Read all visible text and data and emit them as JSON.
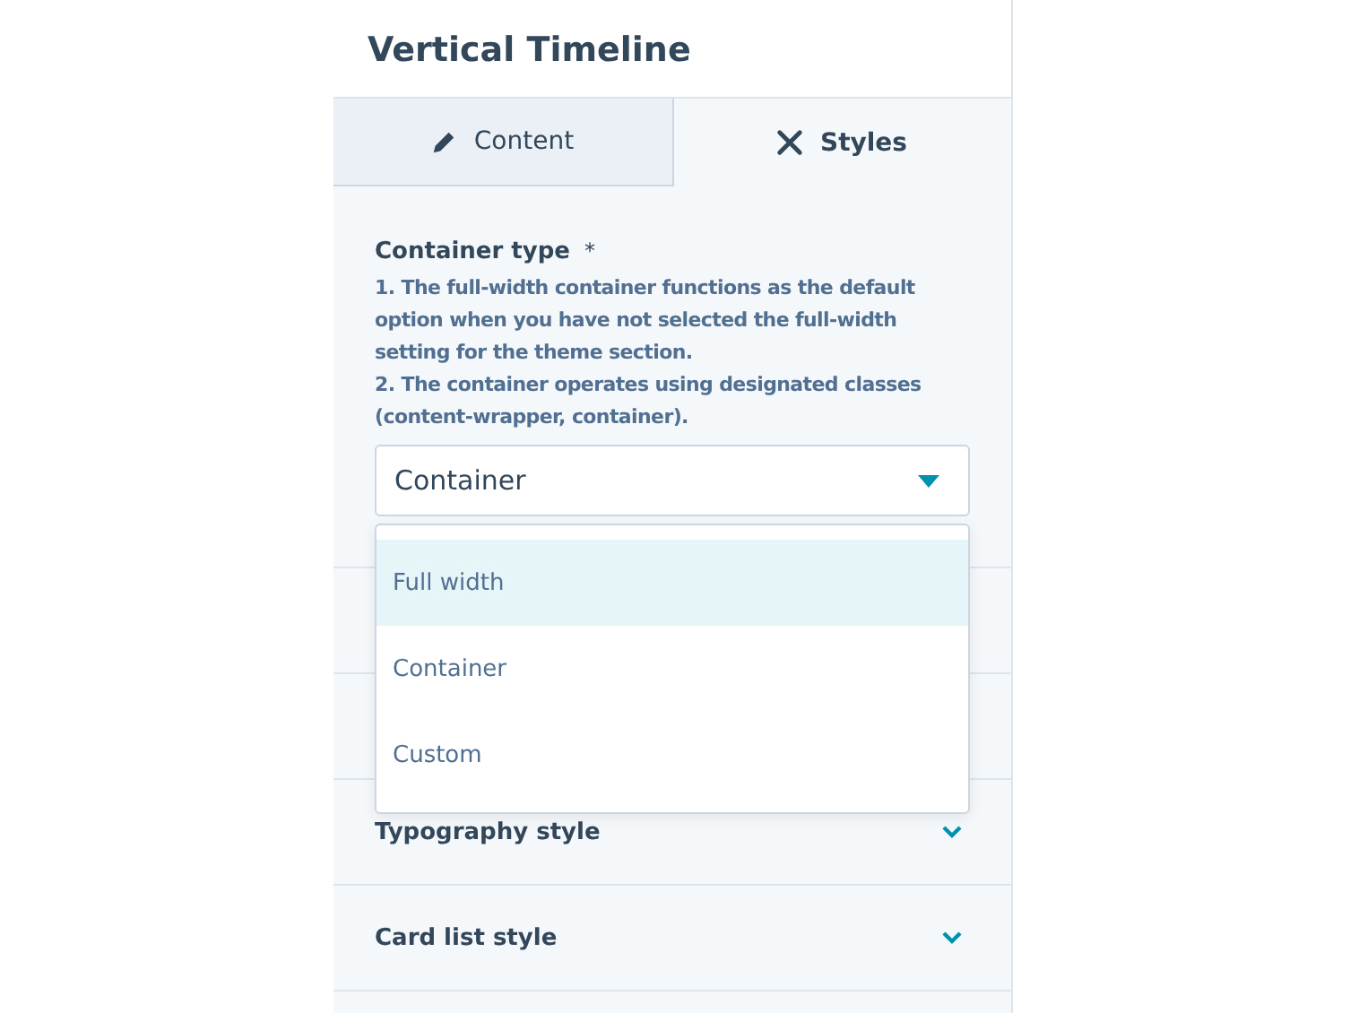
{
  "panel": {
    "title": "Vertical Timeline"
  },
  "tabs": [
    {
      "label": "Content",
      "selected": false
    },
    {
      "label": "Styles",
      "selected": true
    }
  ],
  "field": {
    "label": "Container type",
    "required_mark": "*",
    "help": [
      "1. The full-width container functions as the default option when you have not selected the full-width setting for the theme section.",
      "2. The container operates using designated classes (content-wrapper, container)."
    ],
    "value": "Container",
    "options": [
      {
        "label": "Full width",
        "highlighted": true
      },
      {
        "label": "Container",
        "highlighted": false
      },
      {
        "label": "Custom",
        "highlighted": false
      }
    ]
  },
  "sections": [
    {
      "label": "Typography style",
      "expanded": false
    },
    {
      "label": "Card list style",
      "expanded": false
    }
  ]
}
